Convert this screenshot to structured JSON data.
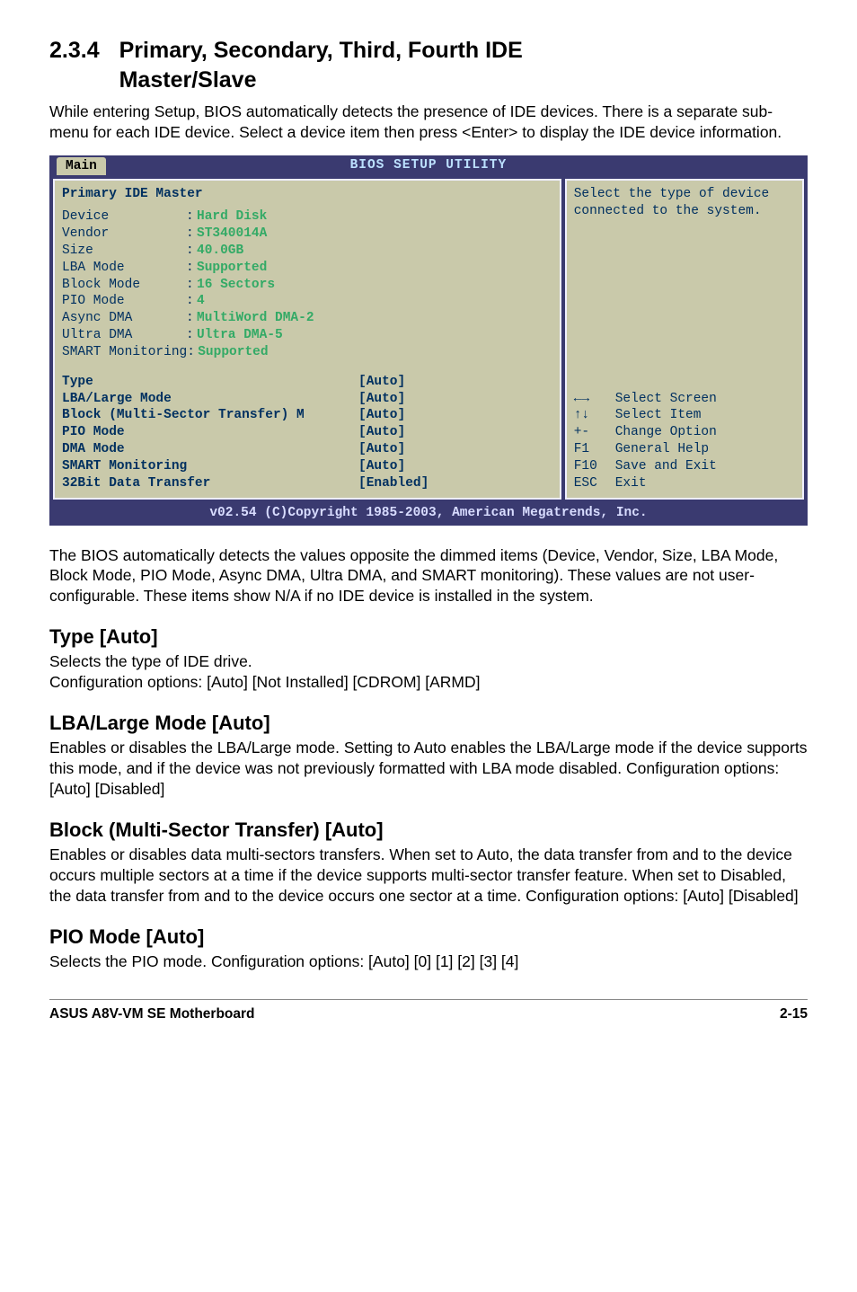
{
  "section": {
    "number": "2.3.4",
    "title_line1": "Primary, Secondary, Third, Fourth IDE",
    "title_line2": "Master/Slave"
  },
  "intro": "While entering Setup, BIOS automatically detects the presence of IDE devices. There is a separate sub-menu for each IDE device. Select a device item then press <Enter> to display the IDE device information.",
  "bios": {
    "title": "BIOS SETUP UTILITY",
    "tab": "Main",
    "panel_header": "Primary IDE Master",
    "detected": [
      {
        "label": "Device",
        "value": "Hard Disk"
      },
      {
        "label": "Vendor",
        "value": "ST340014A"
      },
      {
        "label": "Size",
        "value": "40.0GB"
      },
      {
        "label": "LBA Mode",
        "value": "Supported"
      },
      {
        "label": "Block Mode",
        "value": "16 Sectors"
      },
      {
        "label": "PIO Mode",
        "value": "4"
      },
      {
        "label": "Async DMA",
        "value": "MultiWord DMA-2"
      },
      {
        "label": "Ultra DMA",
        "value": "Ultra DMA-5"
      },
      {
        "label": "SMART Monitoring",
        "value": "Supported",
        "nosep": true
      }
    ],
    "config": [
      {
        "label": "Type",
        "value": "[Auto]"
      },
      {
        "label": "LBA/Large Mode",
        "value": "[Auto]"
      },
      {
        "label": "Block (Multi-Sector Transfer) M",
        "value": "[Auto]"
      },
      {
        "label": "PIO Mode",
        "value": "[Auto]"
      },
      {
        "label": "DMA Mode",
        "value": "[Auto]"
      },
      {
        "label": "SMART Monitoring",
        "value": "[Auto]"
      },
      {
        "label": "32Bit Data Transfer",
        "value": "[Enabled]"
      }
    ],
    "help_top": "Select the type of device connected to the system.",
    "help_keys": [
      {
        "key": "←→",
        "desc": "Select Screen"
      },
      {
        "key": "↑↓",
        "desc": "Select Item"
      },
      {
        "key": "+-",
        "desc": "Change Option"
      },
      {
        "key": "F1",
        "desc": "General Help"
      },
      {
        "key": "F10",
        "desc": "Save and Exit"
      },
      {
        "key": "ESC",
        "desc": "Exit"
      }
    ],
    "footer": "v02.54 (C)Copyright 1985-2003, American Megatrends, Inc."
  },
  "after_bios": "The BIOS automatically detects the values opposite the dimmed items (Device, Vendor, Size, LBA Mode, Block Mode, PIO Mode, Async DMA, Ultra DMA, and SMART monitoring). These values are not user-configurable. These items show  N/A if no IDE device is installed in the system.",
  "type": {
    "heading": "Type [Auto]",
    "l1": "Selects the type of IDE drive.",
    "l2": "Configuration options: [Auto] [Not Installed] [CDROM] [ARMD]"
  },
  "lba": {
    "heading": "LBA/Large Mode [Auto]",
    "p": "Enables or disables the LBA/Large mode. Setting to Auto enables the LBA/Large mode if the device supports this mode, and if the device was not previously formatted with LBA mode disabled. Configuration options: [Auto] [Disabled]"
  },
  "block": {
    "heading": "Block (Multi-Sector Transfer) [Auto]",
    "p": "Enables or disables data multi-sectors transfers. When set to Auto, the data transfer from and to the device occurs multiple sectors at a time if the device supports multi-sector transfer feature. When set to Disabled, the data transfer from and to the device occurs one sector at a time. Configuration options: [Auto] [Disabled]"
  },
  "pio": {
    "heading": "PIO Mode [Auto]",
    "p": "Selects the PIO mode. Configuration options: [Auto] [0] [1] [2] [3] [4]"
  },
  "footer": {
    "left": "ASUS A8V-VM SE Motherboard",
    "right": "2-15"
  }
}
